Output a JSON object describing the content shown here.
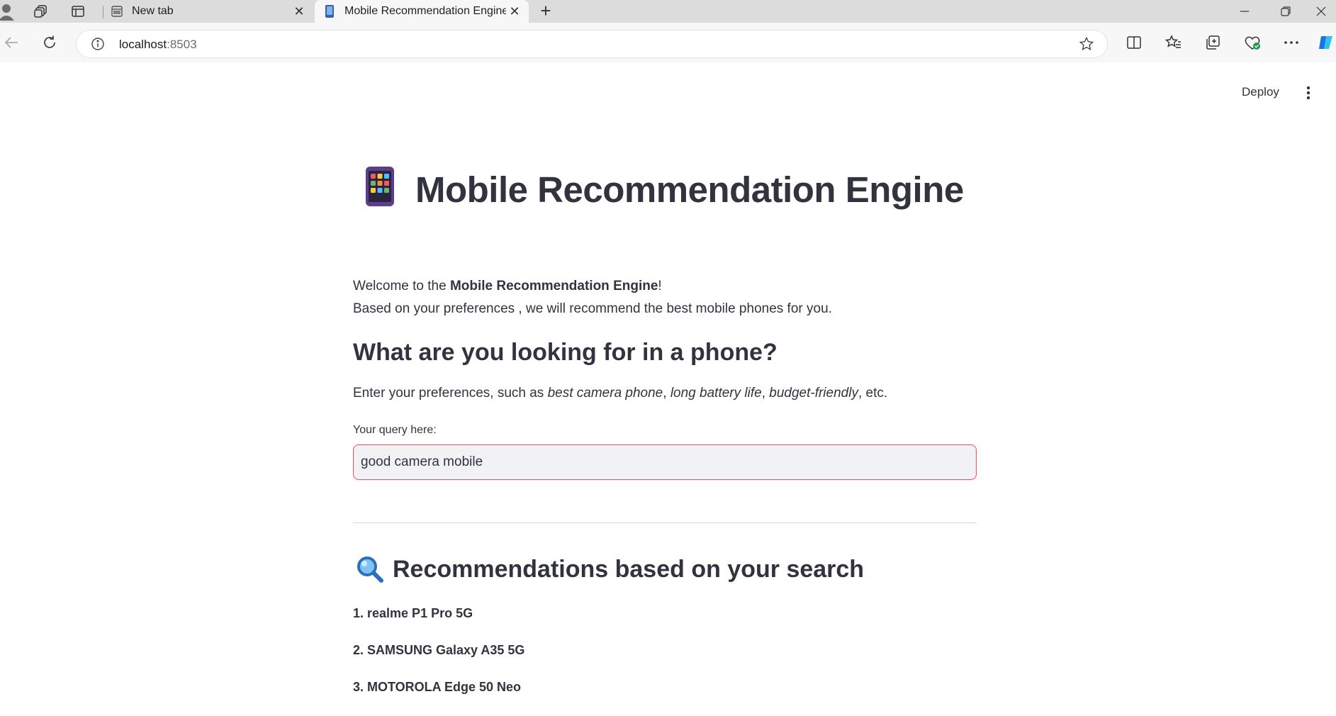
{
  "browser": {
    "tabs": [
      {
        "title": "New tab",
        "active": false
      },
      {
        "title": "Mobile Recommendation Engine",
        "active": true
      }
    ],
    "url_host": "localhost",
    "url_port": ":8503"
  },
  "app": {
    "toolbar": {
      "deploy_label": "Deploy"
    },
    "title": "Mobile Recommendation Engine",
    "intro": {
      "welcome_prefix": "Welcome to the ",
      "welcome_bold": "Mobile Recommendation Engine",
      "welcome_suffix": "!",
      "line2": "Based on your preferences , we will recommend the best mobile phones for you."
    },
    "question_heading": "What are you looking for in a phone?",
    "hint": {
      "prefix": "Enter your preferences, such as ",
      "ex1": "best camera phone",
      "sep1": ", ",
      "ex2": "long battery life",
      "sep2": ", ",
      "ex3": "budget-friendly",
      "suffix": ", etc."
    },
    "query_label": "Your query here:",
    "query_value": "good camera mobile",
    "results_heading": "Recommendations based on your search",
    "recommendations": [
      "1. realme P1 Pro 5G",
      "2. SAMSUNG Galaxy A35 5G",
      "3. MOTOROLA Edge 50 Neo"
    ]
  },
  "colors": {
    "accent": "#ff4b4b",
    "text": "#31333f",
    "input_bg": "#f0f2f6"
  }
}
